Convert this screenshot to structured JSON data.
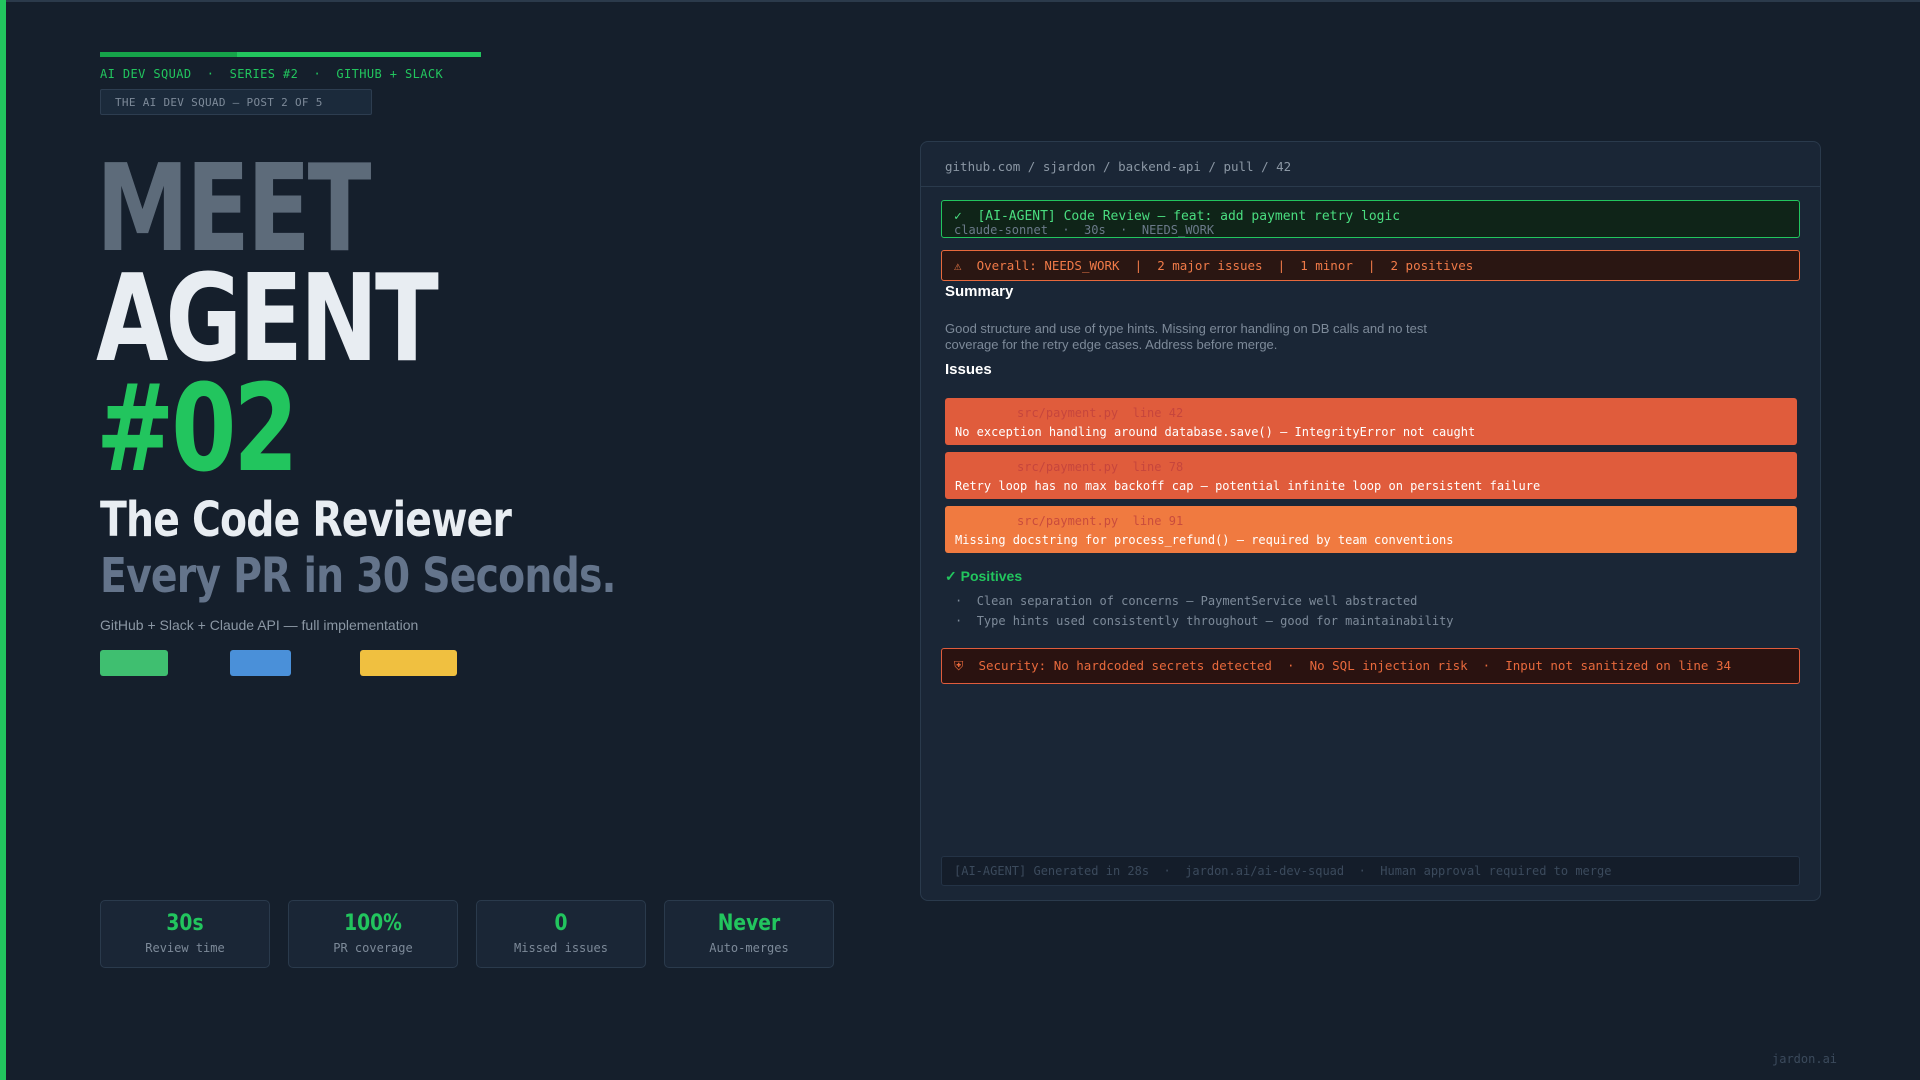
{
  "kicker": "AI DEV SQUAD  ·  SERIES #2  ·  GITHUB + SLACK",
  "post_tag": "THE AI DEV SQUAD — POST 2 OF 5",
  "hero": {
    "line1": "MEET",
    "line2": "AGENT",
    "line3": "#02"
  },
  "subtitle": "The Code Reviewer",
  "subtitle2": "Every PR in 30 Seconds.",
  "tagline": "GitHub + Slack + Claude API — full implementation",
  "series_progress": 0.36,
  "colors": {
    "accent": "#22c55e",
    "major": "#e05c3c",
    "minor": "#f07a40",
    "chip_blue": "#4a90d9",
    "chip_yellow": "#f0c040"
  },
  "stats": [
    {
      "value": "30s",
      "label": "Review time"
    },
    {
      "value": "100%",
      "label": "PR coverage"
    },
    {
      "value": "0",
      "label": "Missed issues"
    },
    {
      "value": "Never",
      "label": "Auto-merges"
    }
  ],
  "review": {
    "url": "github.com / sjardon / backend-api / pull / 42",
    "pr_title": "[AI-AGENT] Code Review — feat: add payment retry logic",
    "pr_meta": "claude-sonnet  ·  30s  ·  NEEDS_WORK",
    "pr_icon": "check-icon",
    "overall": "Overall: NEEDS_WORK  |  2 major issues  |  1 minor  |  2 positives",
    "overall_icon": "warning-icon",
    "summary_heading": "Summary",
    "summary_text": "Good structure and use of type hints. Missing error handling on DB calls and no test coverage for the retry edge cases. Address before merge.",
    "issues_heading": "Issues",
    "issues": [
      {
        "location": "src/payment.py  line 42",
        "message": "No exception handling around database.save() — IntegrityError not caught",
        "severity": "major"
      },
      {
        "location": "src/payment.py  line 78",
        "message": "Retry loop has no max backoff cap — potential infinite loop on persistent failure",
        "severity": "major"
      },
      {
        "location": "src/payment.py  line 91",
        "message": "Missing docstring for process_refund() — required by team conventions",
        "severity": "minor"
      }
    ],
    "positives_heading": "Positives",
    "positives_icon": "check-icon",
    "positives": [
      "Clean separation of concerns — PaymentService well abstracted",
      "Type hints used consistently throughout — good for maintainability"
    ],
    "security": "Security: No hardcoded secrets detected  ·  No SQL injection risk  ·  Input not sanitized on line 34",
    "security_icon": "shield-icon",
    "footer": "[AI-AGENT] Generated in 28s  ·  jardon.ai/ai-dev-squad  ·  Human approval required to merge"
  },
  "brand": "jardon.ai"
}
